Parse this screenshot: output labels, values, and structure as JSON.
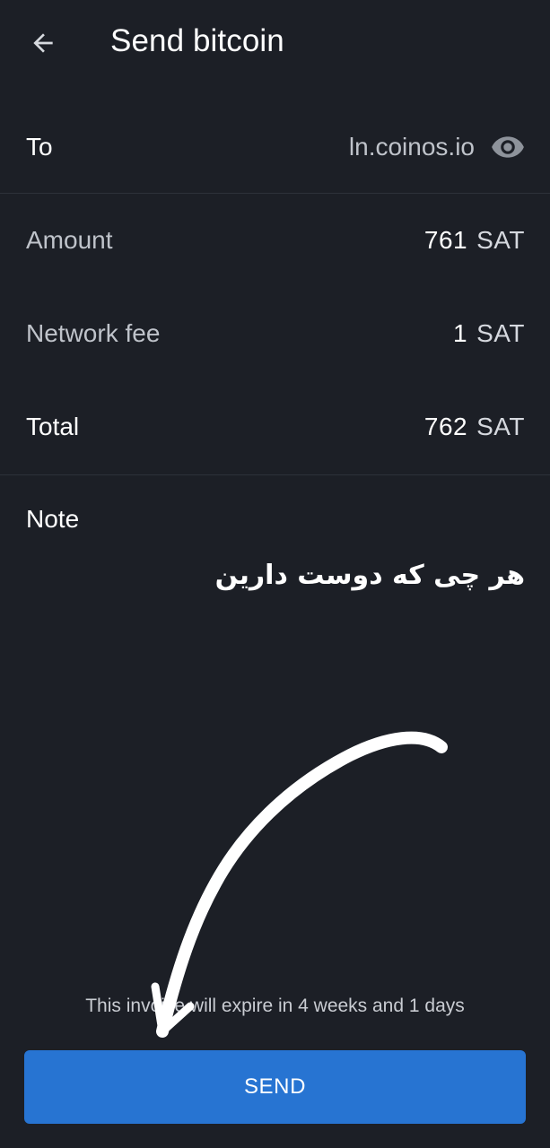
{
  "header": {
    "title": "Send bitcoin",
    "back_icon": "arrow-left-icon"
  },
  "to_row": {
    "label": "To",
    "value": "ln.coinos.io",
    "toggle_icon": "eye-icon"
  },
  "amount_row": {
    "label": "Amount",
    "value": "761",
    "unit": "SAT"
  },
  "fee_row": {
    "label": "Network fee",
    "value": "1",
    "unit": "SAT"
  },
  "total_row": {
    "label": "Total",
    "value": "762",
    "unit": "SAT"
  },
  "note": {
    "label": "Note",
    "text": "هر چی که دوست دارین"
  },
  "expiry_text": "This invoice will expire in 4 weeks and 1 days",
  "send_button": {
    "label": "SEND"
  },
  "colors": {
    "background": "#1c1f26",
    "accent": "#2774d2",
    "muted_text": "#bfc3ca",
    "annotation_arrow": "#ffffff"
  }
}
